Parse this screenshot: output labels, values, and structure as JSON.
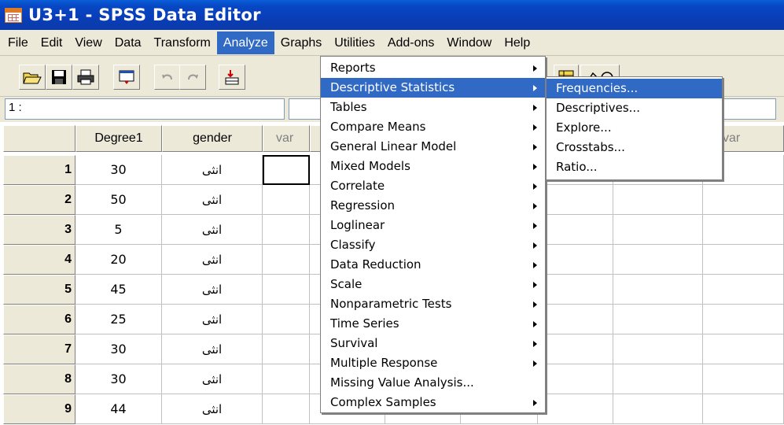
{
  "window": {
    "title": "U3+1 - SPSS Data Editor"
  },
  "menubar": [
    "File",
    "Edit",
    "View",
    "Data",
    "Transform",
    "Analyze",
    "Graphs",
    "Utilities",
    "Add-ons",
    "Window",
    "Help"
  ],
  "cell_reference": "1 :",
  "grid": {
    "columns": [
      "Degree1",
      "gender",
      "var",
      "var"
    ],
    "rows": [
      {
        "num": "1",
        "degree": "30",
        "gender": "انثى"
      },
      {
        "num": "2",
        "degree": "50",
        "gender": "انثى"
      },
      {
        "num": "3",
        "degree": "5",
        "gender": "انثى"
      },
      {
        "num": "4",
        "degree": "20",
        "gender": "انثى"
      },
      {
        "num": "5",
        "degree": "45",
        "gender": "انثى"
      },
      {
        "num": "6",
        "degree": "25",
        "gender": "انثى"
      },
      {
        "num": "7",
        "degree": "30",
        "gender": "انثى"
      },
      {
        "num": "8",
        "degree": "30",
        "gender": "انثى"
      },
      {
        "num": "9",
        "degree": "44",
        "gender": "انثى"
      }
    ]
  },
  "analyze_menu": [
    {
      "label": "Reports",
      "submenu": true
    },
    {
      "label": "Descriptive Statistics",
      "submenu": true
    },
    {
      "label": "Tables",
      "submenu": true
    },
    {
      "label": "Compare Means",
      "submenu": true
    },
    {
      "label": "General Linear Model",
      "submenu": true
    },
    {
      "label": "Mixed Models",
      "submenu": true
    },
    {
      "label": "Correlate",
      "submenu": true
    },
    {
      "label": "Regression",
      "submenu": true
    },
    {
      "label": "Loglinear",
      "submenu": true
    },
    {
      "label": "Classify",
      "submenu": true
    },
    {
      "label": "Data Reduction",
      "submenu": true
    },
    {
      "label": "Scale",
      "submenu": true
    },
    {
      "label": "Nonparametric Tests",
      "submenu": true
    },
    {
      "label": "Time Series",
      "submenu": true
    },
    {
      "label": "Survival",
      "submenu": true
    },
    {
      "label": "Multiple Response",
      "submenu": true
    },
    {
      "label": "Missing Value Analysis...",
      "submenu": false
    },
    {
      "label": "Complex Samples",
      "submenu": true
    }
  ],
  "descriptive_submenu": [
    "Frequencies...",
    "Descriptives...",
    "Explore...",
    "Crosstabs...",
    "Ratio..."
  ],
  "colors": {
    "title_bar": "#0a3db8",
    "highlight": "#316ac5",
    "menu_bg": "#ece9d8"
  }
}
